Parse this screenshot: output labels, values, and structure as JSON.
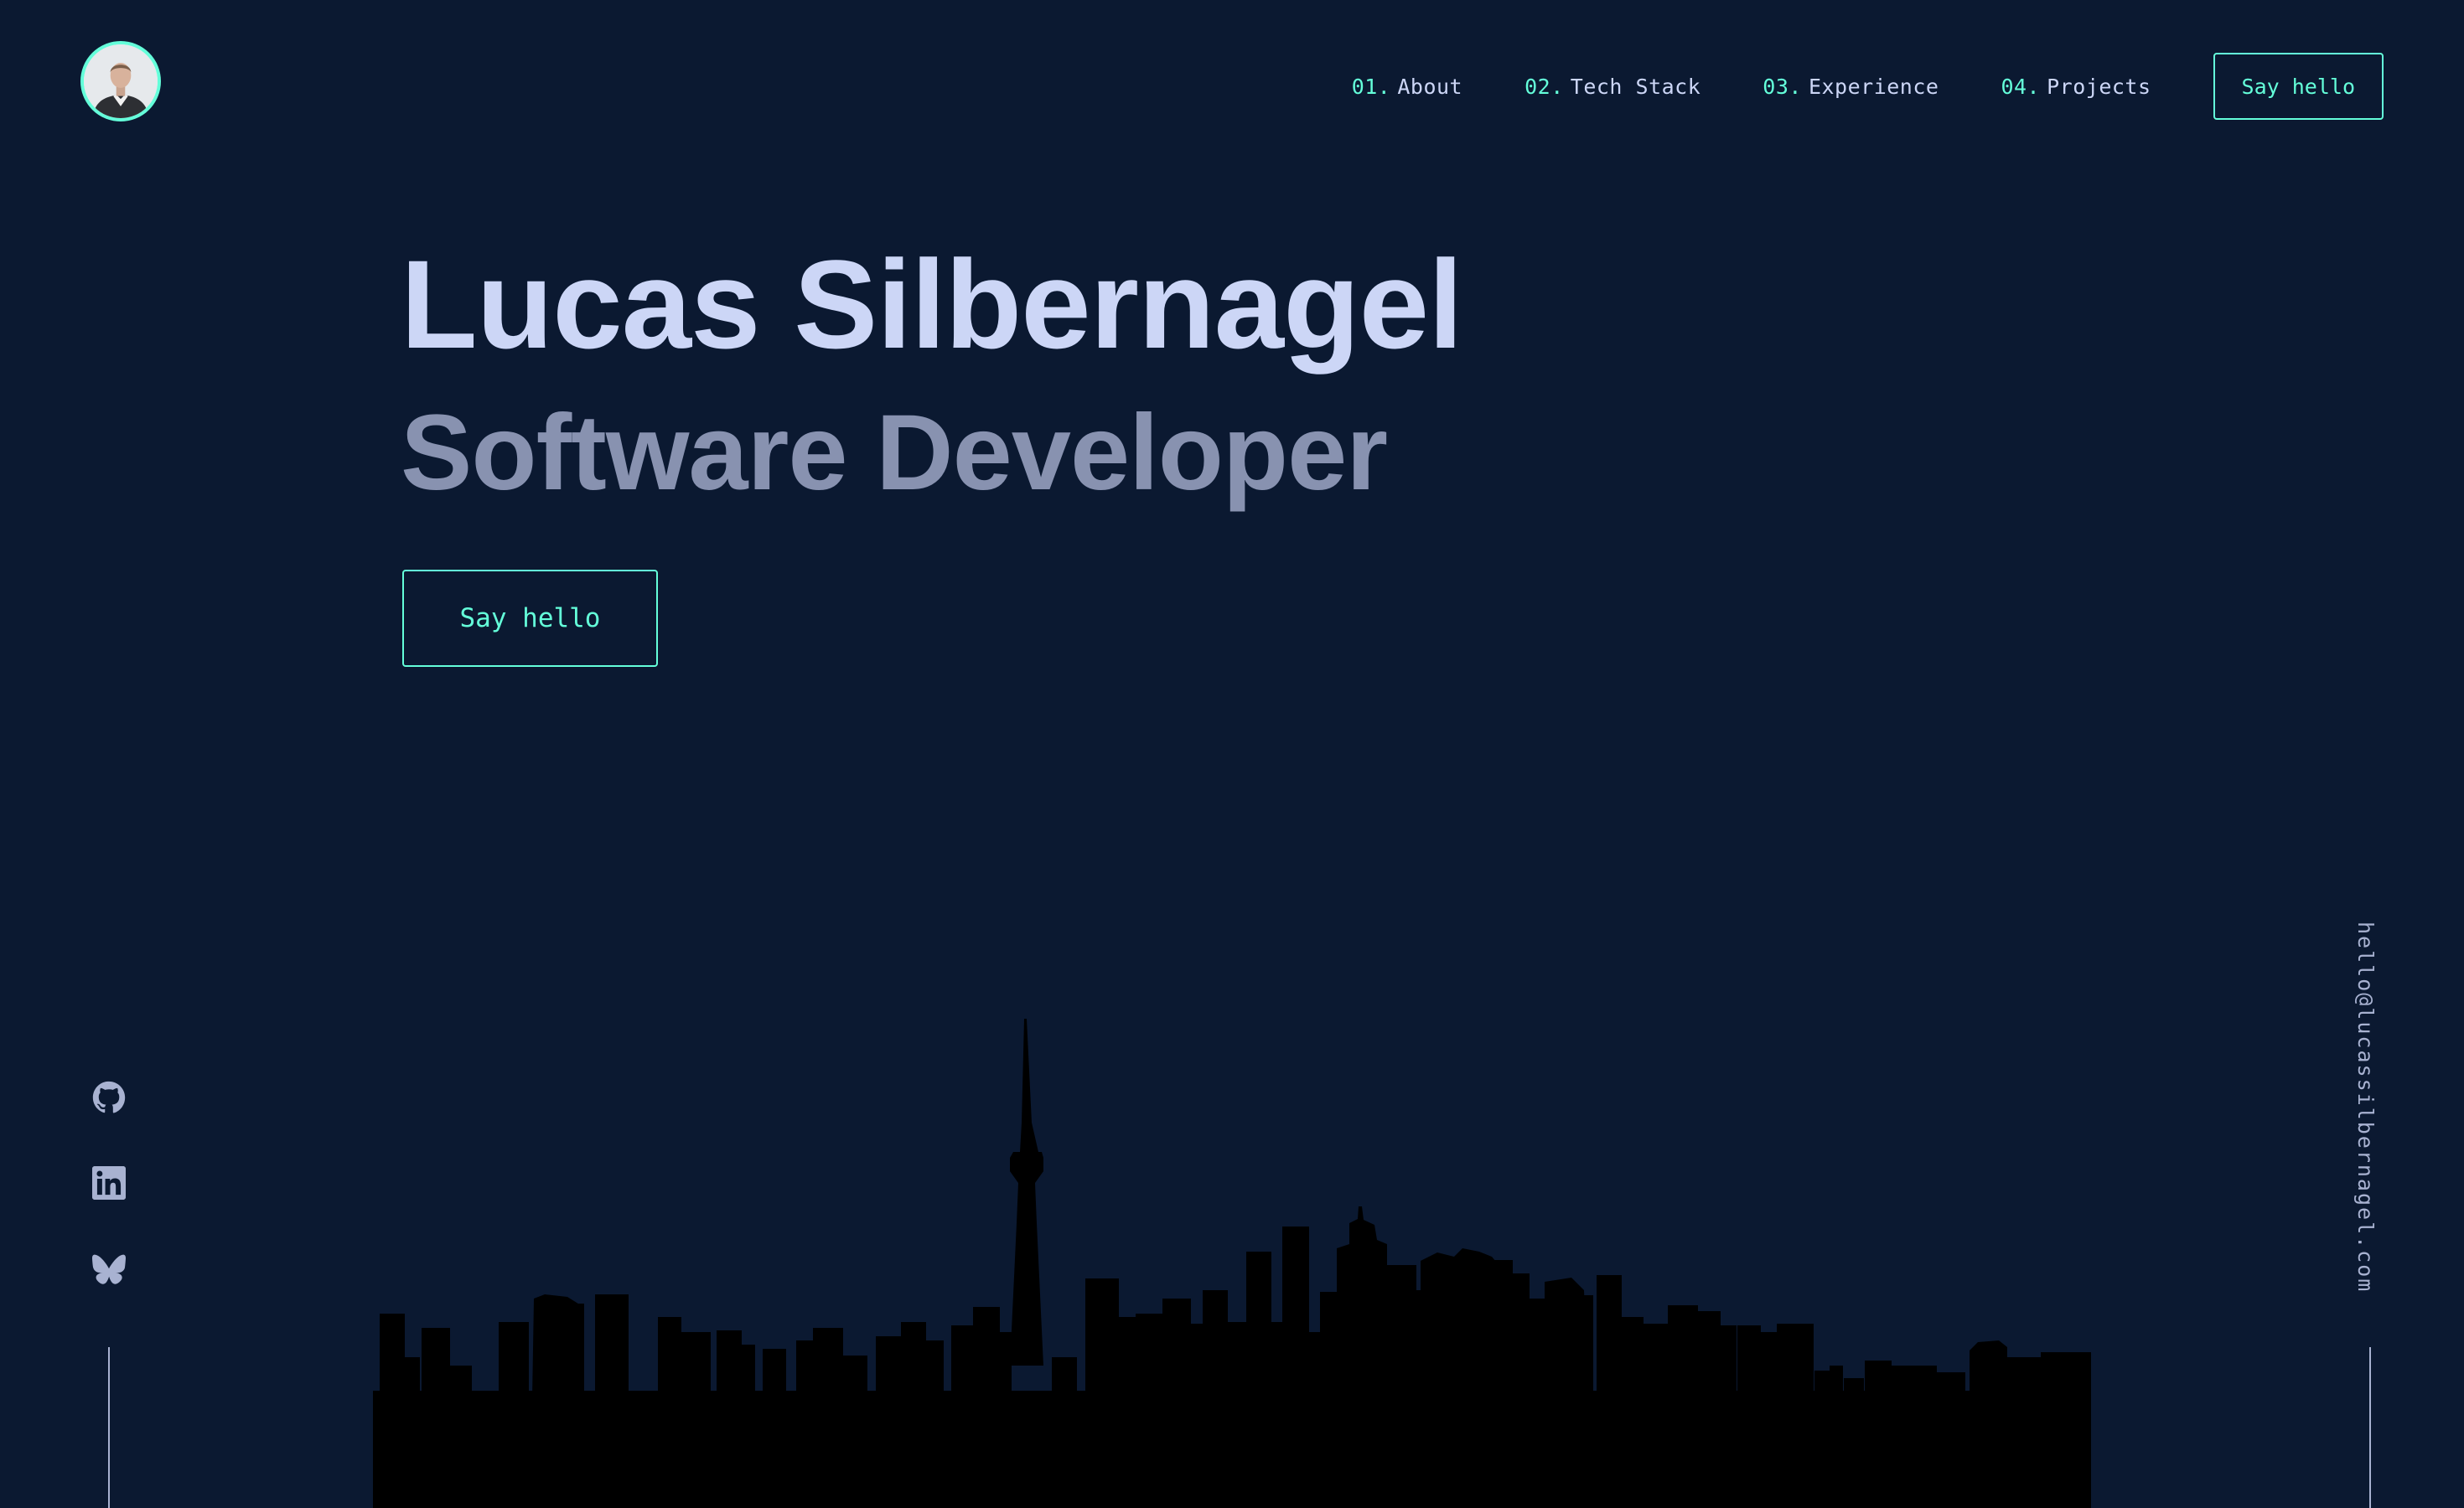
{
  "header": {
    "avatar_alt": "Lucas Silbernagel",
    "nav": [
      {
        "number": "01.",
        "label": "About"
      },
      {
        "number": "02.",
        "label": "Tech Stack"
      },
      {
        "number": "03.",
        "label": "Experience"
      },
      {
        "number": "04.",
        "label": "Projects"
      }
    ],
    "cta_label": "Say hello"
  },
  "hero": {
    "name": "Lucas Silbernagel",
    "role": "Software Developer",
    "cta_label": "Say hello"
  },
  "socials": [
    {
      "name": "github",
      "icon": "github-icon"
    },
    {
      "name": "linkedin",
      "icon": "linkedin-icon"
    },
    {
      "name": "bluesky",
      "icon": "butterfly-icon"
    }
  ],
  "email": "hello@lucassilbernagel.com",
  "colors": {
    "background": "#0b1931",
    "accent": "#64ffda",
    "heading": "#ccd6f6",
    "subheading": "#8892b0",
    "muted": "#a8b2d1",
    "skyline": "#000000"
  }
}
